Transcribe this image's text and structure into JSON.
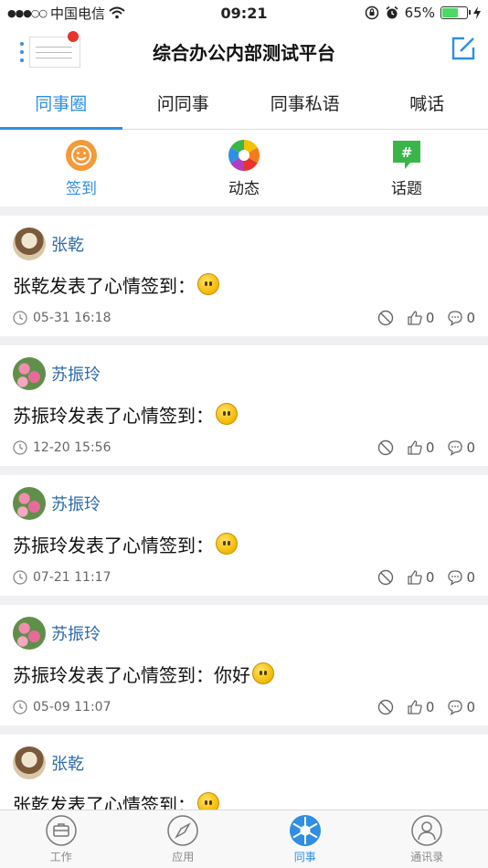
{
  "status_bar": {
    "carrier": "中国电信",
    "time": "09:21",
    "battery_percent": "65%",
    "battery_level": 0.65
  },
  "nav": {
    "title": "综合办公内部测试平台"
  },
  "tabs": [
    {
      "label": "同事圈",
      "active": true
    },
    {
      "label": "问同事",
      "active": false
    },
    {
      "label": "同事私语",
      "active": false
    },
    {
      "label": "喊话",
      "active": false
    }
  ],
  "subcategories": [
    {
      "label": "签到",
      "icon": "smile-checkin-icon",
      "active": true
    },
    {
      "label": "动态",
      "icon": "aperture-icon",
      "active": false
    },
    {
      "label": "话题",
      "icon": "hashtag-icon",
      "active": false
    }
  ],
  "posts": [
    {
      "author": "张乾",
      "avatar": "cone",
      "text": "张乾发表了心情签到：",
      "time": "05-31 16:18",
      "likes": "0",
      "comments": "0"
    },
    {
      "author": "苏振玲",
      "avatar": "flower",
      "text": "苏振玲发表了心情签到：",
      "time": "12-20 15:56",
      "likes": "0",
      "comments": "0"
    },
    {
      "author": "苏振玲",
      "avatar": "flower",
      "text": "苏振玲发表了心情签到：",
      "time": "07-21 11:17",
      "likes": "0",
      "comments": "0"
    },
    {
      "author": "苏振玲",
      "avatar": "flower",
      "text": "苏振玲发表了心情签到：你好",
      "time": "05-09 11:07",
      "likes": "0",
      "comments": "0"
    },
    {
      "author": "张乾",
      "avatar": "cone",
      "text": "张乾发表了心情签到：",
      "time": "",
      "likes": "",
      "comments": ""
    }
  ],
  "tabbar": [
    {
      "label": "工作",
      "icon": "briefcase-icon",
      "active": false
    },
    {
      "label": "应用",
      "icon": "compass-icon",
      "active": false
    },
    {
      "label": "同事",
      "icon": "aperture-icon",
      "active": true
    },
    {
      "label": "通讯录",
      "icon": "contact-icon",
      "active": false
    }
  ],
  "colors": {
    "accent": "#2e8fe3",
    "author": "#2e6aa8"
  }
}
